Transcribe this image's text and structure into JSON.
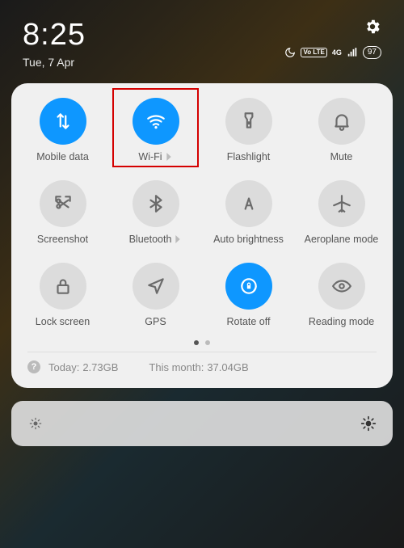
{
  "status": {
    "time": "8:25",
    "date": "Tue, 7 Apr",
    "volte_badge": "Vo LTE",
    "network_label": "4G",
    "battery": "97"
  },
  "tiles": {
    "mobile_data": "Mobile data",
    "wifi": "Wi-Fi",
    "flashlight": "Flashlight",
    "mute": "Mute",
    "screenshot": "Screenshot",
    "bluetooth": "Bluetooth",
    "auto_brightness": "Auto brightness",
    "aeroplane": "Aeroplane mode",
    "lock_screen": "Lock screen",
    "gps": "GPS",
    "rotate": "Rotate off",
    "reading": "Reading mode"
  },
  "usage": {
    "today_label": "Today:",
    "today_value": "2.73GB",
    "month_label": "This month:",
    "month_value": "37.04GB"
  }
}
